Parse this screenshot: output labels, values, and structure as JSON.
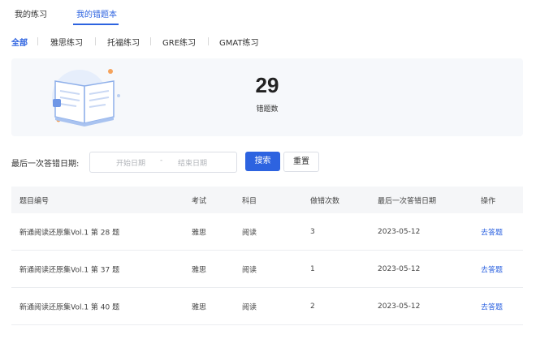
{
  "tabs": [
    {
      "label": "我的练习"
    },
    {
      "label": "我的错题本"
    }
  ],
  "filters": [
    {
      "label": "全部"
    },
    {
      "label": "雅思练习"
    },
    {
      "label": "托福练习"
    },
    {
      "label": "GRE练习"
    },
    {
      "label": "GMAT练习"
    }
  ],
  "stats": {
    "count": "29",
    "label": "错题数"
  },
  "search": {
    "label": "最后一次答错日期:",
    "start_placeholder": "开始日期",
    "separator": "-",
    "end_placeholder": "结束日期",
    "search_button": "搜索",
    "reset_button": "重置"
  },
  "table": {
    "headers": [
      "题目编号",
      "考试",
      "科目",
      "做错次数",
      "最后一次答错日期",
      "操作"
    ],
    "rows": [
      {
        "question": "新通阅读还原集Vol.1 第 28 题",
        "exam": "雅思",
        "subject": "阅读",
        "wrong_count": "3",
        "last_date": "2023-05-12",
        "action": "去答题"
      },
      {
        "question": "新通阅读还原集Vol.1 第 37 题",
        "exam": "雅思",
        "subject": "阅读",
        "wrong_count": "1",
        "last_date": "2023-05-12",
        "action": "去答题"
      },
      {
        "question": "新通阅读还原集Vol.1 第 40 题",
        "exam": "雅思",
        "subject": "阅读",
        "wrong_count": "2",
        "last_date": "2023-05-12",
        "action": "去答题"
      }
    ]
  },
  "colors": {
    "accent": "#2d63e0",
    "panel_bg": "#f6f8fb",
    "header_bg": "#f5f6f8"
  }
}
